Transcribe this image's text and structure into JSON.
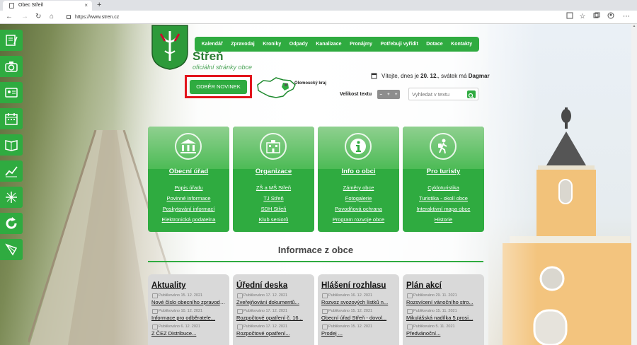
{
  "browser": {
    "tab_title": "Obec Střeň",
    "url": "https://www.stren.cz",
    "new_tab": "+",
    "tab_close": "×",
    "nav": {
      "back": "←",
      "forward": "→",
      "reload": "↻",
      "home": "⌂"
    }
  },
  "header": {
    "title": "Střeň",
    "subtitle": "oficiální stránky obce",
    "nav_items": [
      "Kalendář",
      "Zpravodaj",
      "Kroniky",
      "Odpady",
      "Kanalizace",
      "Pronájmy",
      "Potřebuji vyřídit",
      "Dotace",
      "Kontakty"
    ],
    "subscribe_label": "ODBĚR NOVINEK",
    "region_label": "Olomoucký kraj",
    "date_prefix": "Vítejte, dnes je",
    "date_value": "20. 12.",
    "nameday_prefix": ", svátek má",
    "nameday_value": "Dagmar",
    "font_size_label": "Velikost textu",
    "font_buttons": [
      "–",
      "+",
      "+"
    ],
    "search_placeholder": "Vyhledat v textu"
  },
  "sidebar_icons": [
    "forms-icon",
    "camera-icon",
    "id-card-icon",
    "calendar-icon",
    "book-icon",
    "chart-icon",
    "sparkle-icon",
    "recycle-icon",
    "kite-icon"
  ],
  "cards": [
    {
      "title": "Obecní úřad",
      "icon": "building-icon",
      "links": [
        "Popis úřadu",
        "Povinné informace",
        "Poskytování informací",
        "Elektronická podatelna"
      ]
    },
    {
      "title": "Organizace",
      "icon": "organization-icon",
      "links": [
        "ZŠ a MŠ Střeň",
        "TJ Střeň",
        "SDH Střeň",
        "Klub seniorů"
      ]
    },
    {
      "title": "Info o obci",
      "icon": "info-icon",
      "links": [
        "Záměry obce",
        "Fotogalerie",
        "Povodňová ochrana",
        "Program rozvoje obce"
      ]
    },
    {
      "title": "Pro turisty",
      "icon": "tourist-icon",
      "links": [
        "Cykloturistika",
        "Turistika - okolí obce",
        "Interaktivní mapa obce",
        "Historie"
      ]
    }
  ],
  "info_heading": "Informace z obce",
  "news": [
    {
      "title": "Aktuality",
      "items": [
        {
          "date": "Publikováno 15. 12. 2021",
          "text": "Nové číslo obecního zpravodaje"
        },
        {
          "date": "Publikováno 10. 12. 2021",
          "text": "Informace pro odběratele..."
        },
        {
          "date": "Publikováno 6. 12. 2021",
          "text": "Z ČEZ Distribuce..."
        }
      ]
    },
    {
      "title": "Úřední deska",
      "items": [
        {
          "date": "Publikováno 17. 12. 2021",
          "text": "Zveřejňování dokumentů..."
        },
        {
          "date": "Publikováno 17. 12. 2021",
          "text": "Rozpočtové opatření č. 16..."
        },
        {
          "date": "Publikováno 17. 12. 2021",
          "text": "Rozpočtové opatření..."
        }
      ]
    },
    {
      "title": "Hlášení rozhlasu",
      "items": [
        {
          "date": "Publikováno 16. 12. 2021",
          "text": "Rozvoz svozových lístků n..."
        },
        {
          "date": "Publikováno 15. 12. 2021",
          "text": "Obecní úřad Střeň - dovol..."
        },
        {
          "date": "Publikováno 15. 12. 2021",
          "text": "Prodej ..."
        }
      ]
    },
    {
      "title": "Plán akcí",
      "items": [
        {
          "date": "Publikováno 29. 11. 2021",
          "text": "Rozsvícení vánočního stro..."
        },
        {
          "date": "Publikováno 15. 11. 2021",
          "text": "Mikulášská nadílka 5.prosi..."
        },
        {
          "date": "Publikováno 5. 11. 2021",
          "text": "Předvánoční..."
        }
      ]
    }
  ],
  "colors": {
    "brand_green": "#2fab40",
    "dark_green": "#2c7d34",
    "highlight_red": "#e2141c"
  }
}
